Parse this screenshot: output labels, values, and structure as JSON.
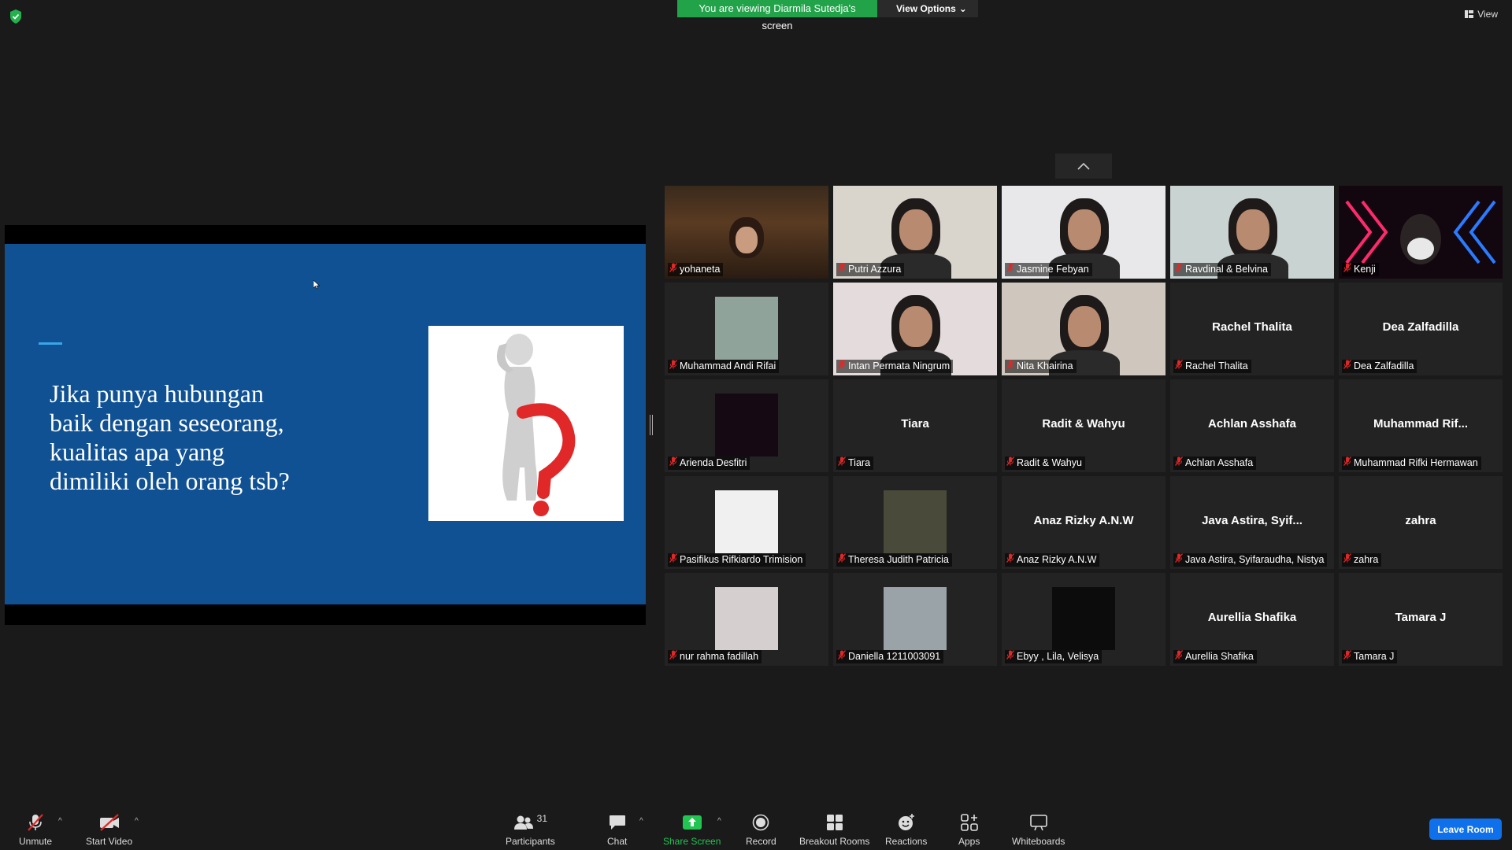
{
  "banner": {
    "viewing_text": "You are viewing Diarmila Sutedja's screen",
    "view_options": "View Options"
  },
  "top_right": {
    "view_label": "View"
  },
  "slide": {
    "text": "Jika punya hubungan baik dengan seseorang, kualitas apa yang dimiliki oleh orang tsb?"
  },
  "participants_tiles": [
    {
      "name": "yohaneta"
    },
    {
      "name": "Putri Azzura"
    },
    {
      "name": "Jasmine Febyan"
    },
    {
      "name": "Ravdinal & Belvina"
    },
    {
      "name": "Kenji"
    },
    {
      "name": "Muhammad Andi Rifai"
    },
    {
      "name": "Intan Permata Ningrum"
    },
    {
      "name": "Nita Khairina"
    },
    {
      "name": "Rachel Thalita",
      "display": "Rachel Thalita"
    },
    {
      "name": "Dea Zalfadilla",
      "display": "Dea Zalfadilla"
    },
    {
      "name": "Arienda Desfitri"
    },
    {
      "name": "Tiara",
      "display": "Tiara"
    },
    {
      "name": "Radit & Wahyu",
      "display": "Radit & Wahyu"
    },
    {
      "name": "Achlan Asshafa",
      "display": "Achlan Asshafa"
    },
    {
      "name": "Muhammad Rifki Hermawan",
      "display": "Muhammad  Rif..."
    },
    {
      "name": "Pasifikus Rifkiardo Trimision"
    },
    {
      "name": "Theresa Judith Patricia"
    },
    {
      "name": "Anaz Rizky A.N.W",
      "display": "Anaz Rizky A.N.W"
    },
    {
      "name": "Java Astira, Syifaraudha, Nistya",
      "display": "Java Astira, Syif..."
    },
    {
      "name": "zahra",
      "display": "zahra"
    },
    {
      "name": "nur rahma fadillah"
    },
    {
      "name": "Daniella 1211003091"
    },
    {
      "name": "Ebyy , Lila, Velisya"
    },
    {
      "name": "Aurellia Shafika",
      "display": "Aurellia Shafika"
    },
    {
      "name": "Tamara J",
      "display": "Tamara J"
    }
  ],
  "toolbar": {
    "unmute": "Unmute",
    "start_video": "Start Video",
    "participants": "Participants",
    "participants_count": "31",
    "chat": "Chat",
    "share_screen": "Share Screen",
    "record": "Record",
    "breakout_rooms": "Breakout Rooms",
    "reactions": "Reactions",
    "apps": "Apps",
    "whiteboards": "Whiteboards",
    "leave_room": "Leave Room"
  },
  "colors": {
    "share_green": "#22a34a",
    "slide_blue": "#0f5193",
    "leave_blue": "#0e71eb",
    "mute_red": "#e02828"
  }
}
